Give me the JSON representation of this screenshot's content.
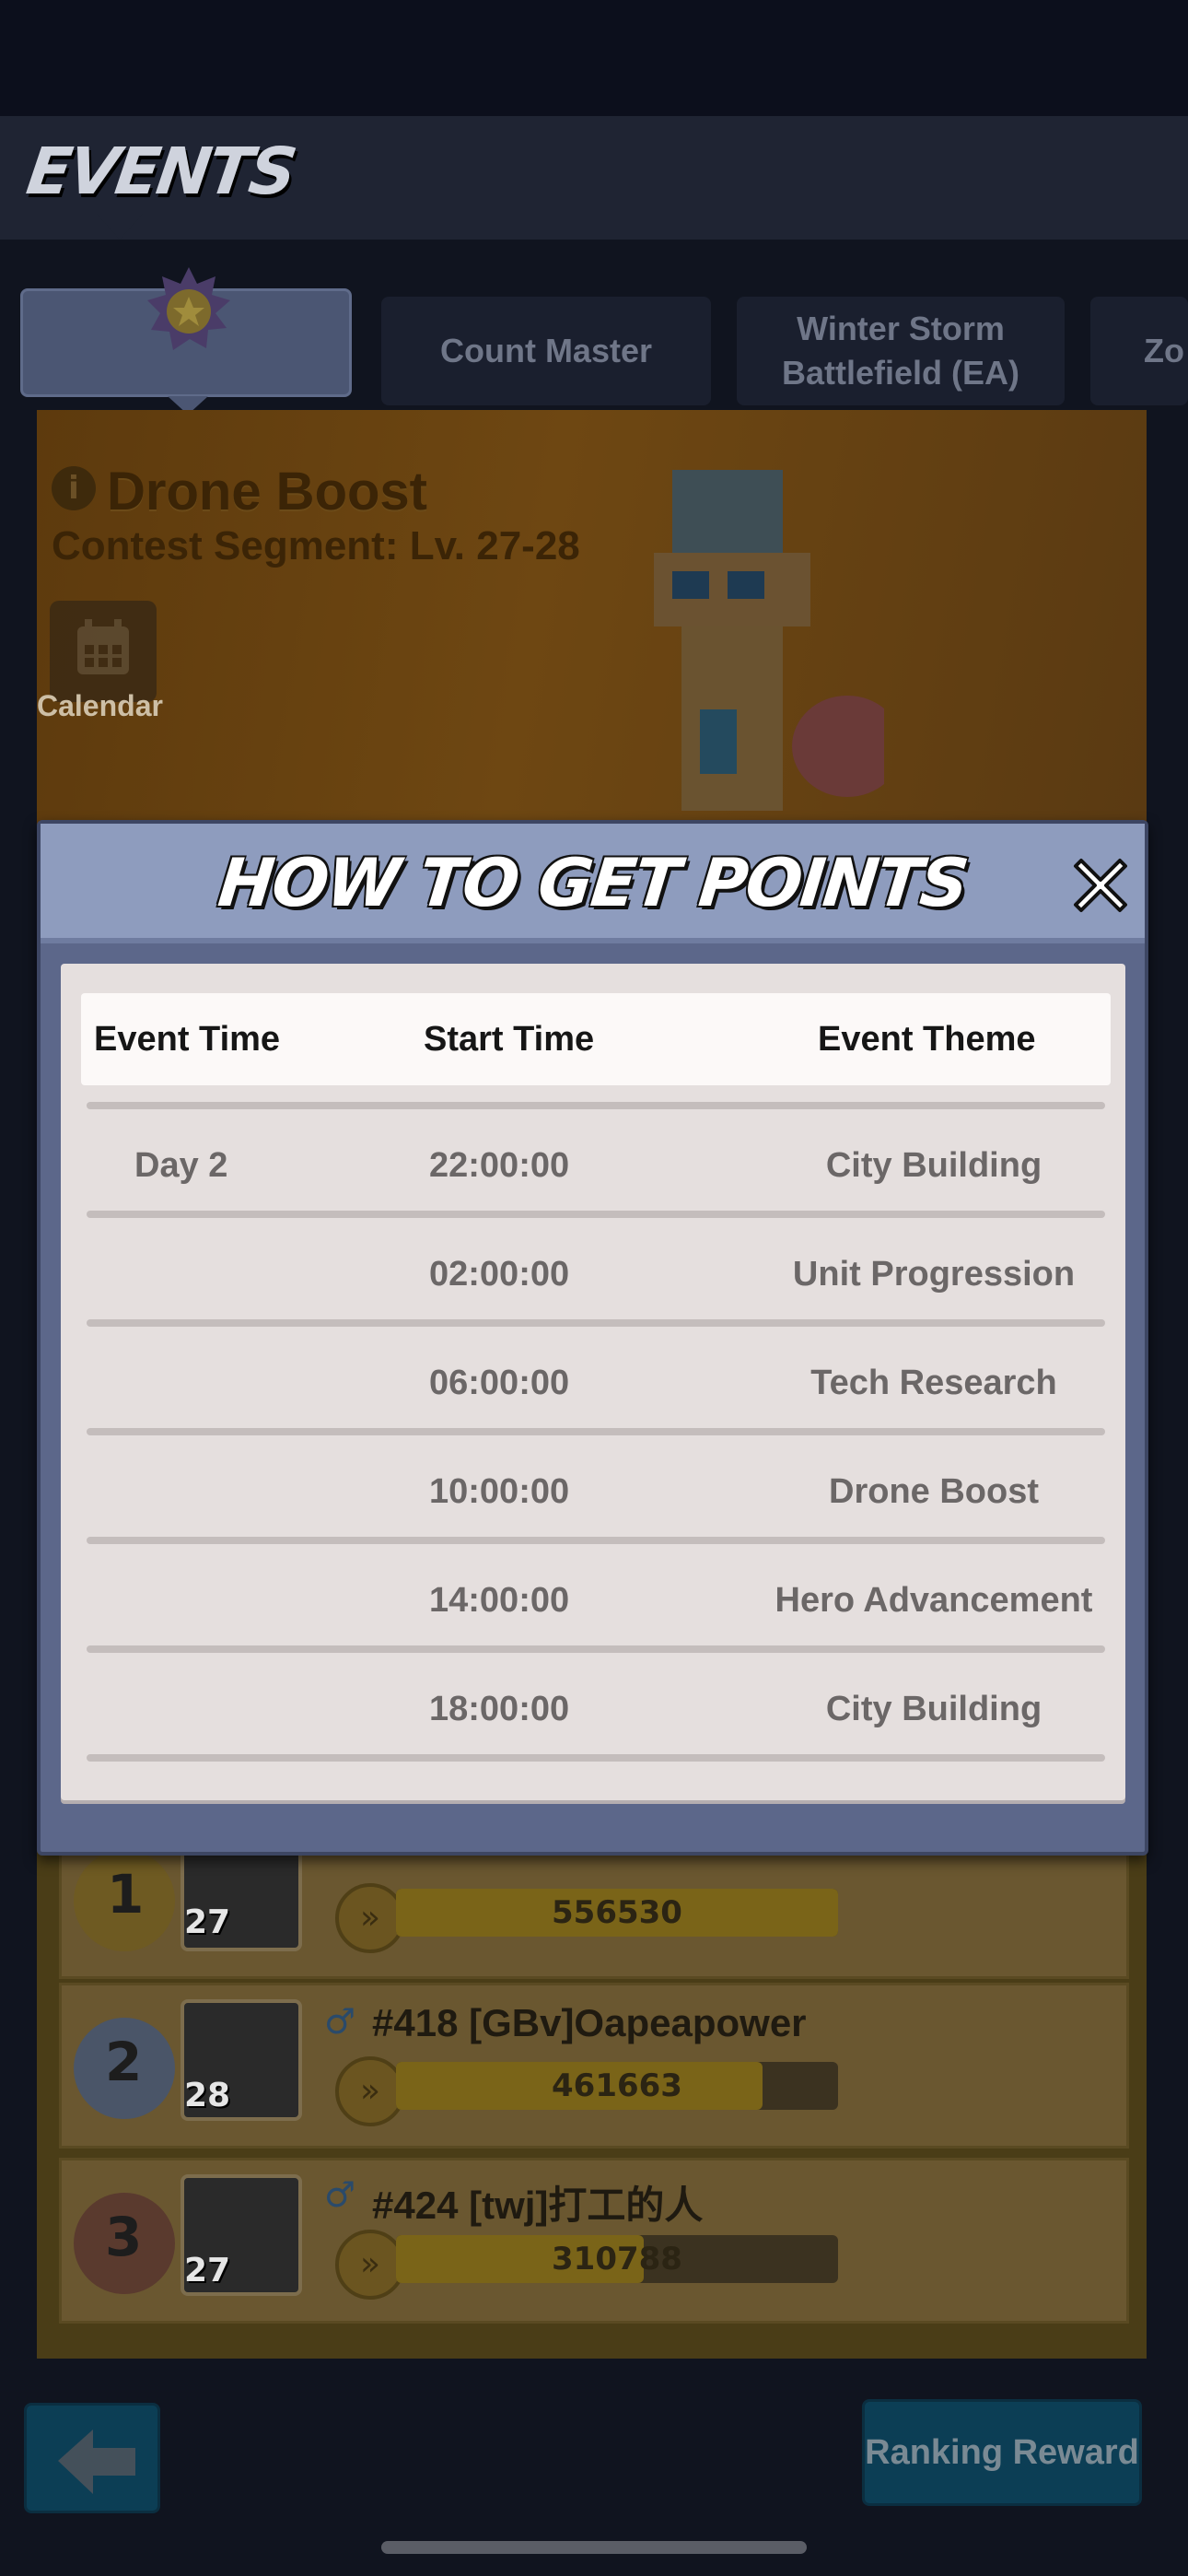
{
  "header": {
    "title": "EVENTS"
  },
  "tabs": [
    {
      "label": "",
      "active": true,
      "icon": "medal-icon"
    },
    {
      "label": "Count Master"
    },
    {
      "label": "Winter Storm Battlefield (EA)"
    },
    {
      "label": "Zo"
    }
  ],
  "banner": {
    "title": "Drone Boost",
    "subtitle": "Contest Segment: Lv. 27-28",
    "calendar_label": "Calendar"
  },
  "modal": {
    "title": "HOW TO GET POINTS",
    "columns": [
      "Event Time",
      "Start Time",
      "Event Theme"
    ],
    "rows": [
      {
        "event_time": "Day 2",
        "start_time": "22:00:00",
        "theme": "City Building"
      },
      {
        "event_time": "",
        "start_time": "02:00:00",
        "theme": "Unit Progression"
      },
      {
        "event_time": "",
        "start_time": "06:00:00",
        "theme": "Tech Research"
      },
      {
        "event_time": "",
        "start_time": "10:00:00",
        "theme": "Drone Boost"
      },
      {
        "event_time": "",
        "start_time": "14:00:00",
        "theme": "Hero Advancement"
      },
      {
        "event_time": "",
        "start_time": "18:00:00",
        "theme": "City Building"
      }
    ]
  },
  "ranking": [
    {
      "rank": "1",
      "level": "27",
      "name": "",
      "score": "556530",
      "fill": 1.0
    },
    {
      "rank": "2",
      "level": "28",
      "name": "#418 [GBv]Oapeapower",
      "score": "461663",
      "fill": 0.83
    },
    {
      "rank": "3",
      "level": "27",
      "name": "#424 [twj]打工的人",
      "score": "310788",
      "fill": 0.56
    }
  ],
  "footer": {
    "reward_label": "Ranking Reward"
  },
  "colors": {
    "modal_header": "#8e9cbe",
    "modal_body": "#5c678a",
    "table_bg": "#e5dfde",
    "table_head_bg": "#fcf9f8"
  }
}
